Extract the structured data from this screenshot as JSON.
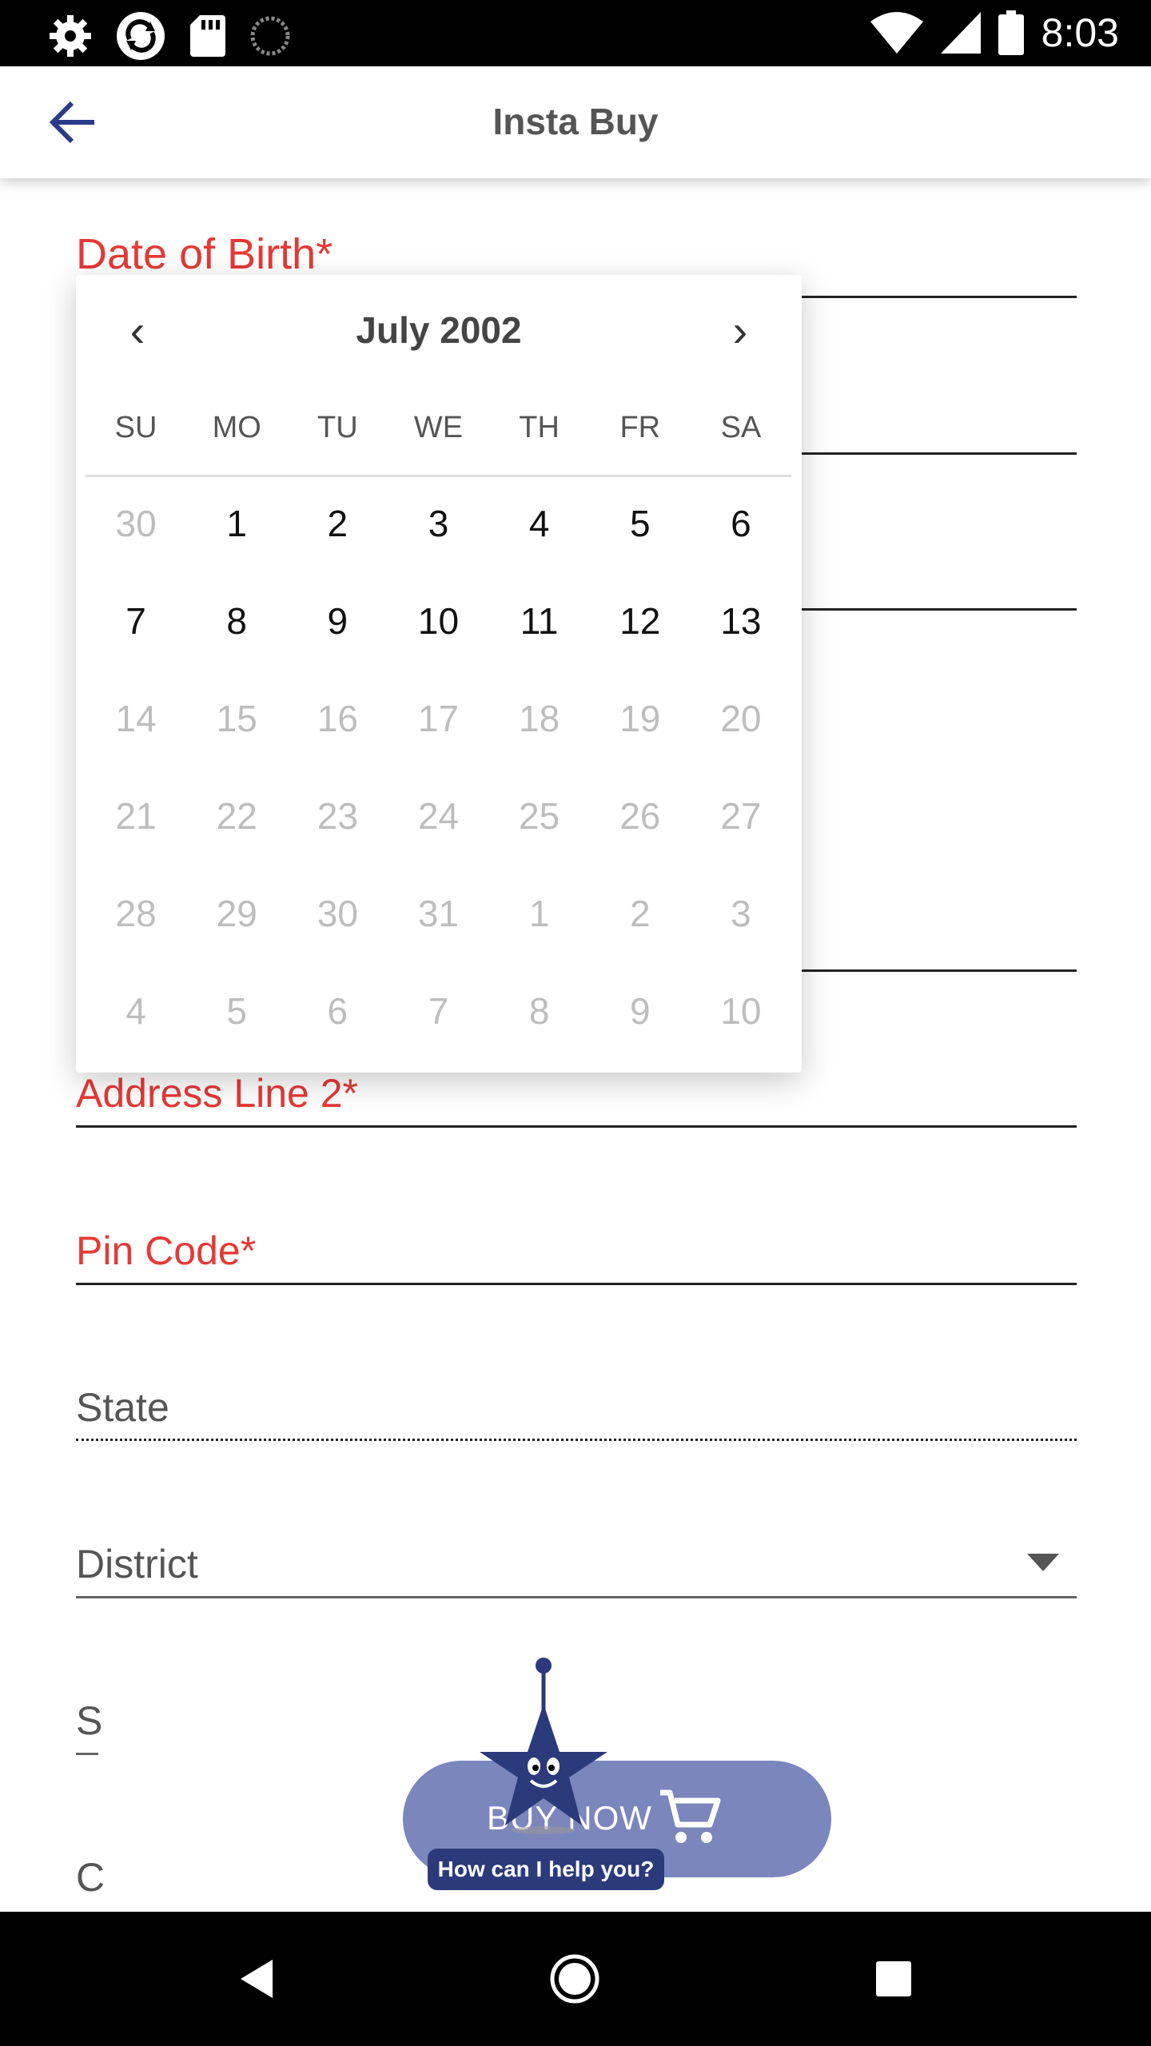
{
  "status_bar": {
    "time": "8:03",
    "icons": [
      "settings-icon",
      "sync-icon",
      "sd-card-icon",
      "loading-icon",
      "wifi-icon",
      "cell-signal-icon",
      "battery-icon"
    ]
  },
  "app_bar": {
    "title": "Insta Buy",
    "back_icon": "arrow-back-icon"
  },
  "form": {
    "fields": [
      {
        "label": "Date of Birth*",
        "style": "error"
      },
      {
        "label": "Address Line 2*",
        "style": "error"
      },
      {
        "label": "Pin Code*",
        "style": "error"
      },
      {
        "label": "State",
        "style": "disabled"
      },
      {
        "label": "District",
        "style": "dropdown"
      },
      {
        "label": "S",
        "style": "partial"
      },
      {
        "label": "C",
        "style": "partial"
      }
    ]
  },
  "date_picker": {
    "month_label": "July 2002",
    "prev": "‹",
    "next": "›",
    "weekdays": [
      "SU",
      "MO",
      "TU",
      "WE",
      "TH",
      "FR",
      "SA"
    ],
    "weeks": [
      [
        {
          "d": "30",
          "m": true
        },
        {
          "d": "1",
          "m": false
        },
        {
          "d": "2",
          "m": false
        },
        {
          "d": "3",
          "m": false
        },
        {
          "d": "4",
          "m": false
        },
        {
          "d": "5",
          "m": false
        },
        {
          "d": "6",
          "m": false
        }
      ],
      [
        {
          "d": "7",
          "m": false
        },
        {
          "d": "8",
          "m": false
        },
        {
          "d": "9",
          "m": false
        },
        {
          "d": "10",
          "m": false
        },
        {
          "d": "11",
          "m": false
        },
        {
          "d": "12",
          "m": false
        },
        {
          "d": "13",
          "m": false
        }
      ],
      [
        {
          "d": "14",
          "m": true
        },
        {
          "d": "15",
          "m": true
        },
        {
          "d": "16",
          "m": true
        },
        {
          "d": "17",
          "m": true
        },
        {
          "d": "18",
          "m": true
        },
        {
          "d": "19",
          "m": true
        },
        {
          "d": "20",
          "m": true
        }
      ],
      [
        {
          "d": "21",
          "m": true
        },
        {
          "d": "22",
          "m": true
        },
        {
          "d": "23",
          "m": true
        },
        {
          "d": "24",
          "m": true
        },
        {
          "d": "25",
          "m": true
        },
        {
          "d": "26",
          "m": true
        },
        {
          "d": "27",
          "m": true
        }
      ],
      [
        {
          "d": "28",
          "m": true
        },
        {
          "d": "29",
          "m": true
        },
        {
          "d": "30",
          "m": true
        },
        {
          "d": "31",
          "m": true
        },
        {
          "d": "1",
          "m": true
        },
        {
          "d": "2",
          "m": true
        },
        {
          "d": "3",
          "m": true
        }
      ],
      [
        {
          "d": "4",
          "m": true
        },
        {
          "d": "5",
          "m": true
        },
        {
          "d": "6",
          "m": true
        },
        {
          "d": "7",
          "m": true
        },
        {
          "d": "8",
          "m": true
        },
        {
          "d": "9",
          "m": true
        },
        {
          "d": "10",
          "m": true
        }
      ]
    ]
  },
  "buy_now": {
    "label": "BUY NOW",
    "icon": "cart-icon"
  },
  "assistant": {
    "help_text": "How can I help you?",
    "icon": "star-mascot-icon"
  },
  "colors": {
    "error": "#e53935",
    "primary": "#2b3a7a",
    "button": "#7b86bd"
  }
}
